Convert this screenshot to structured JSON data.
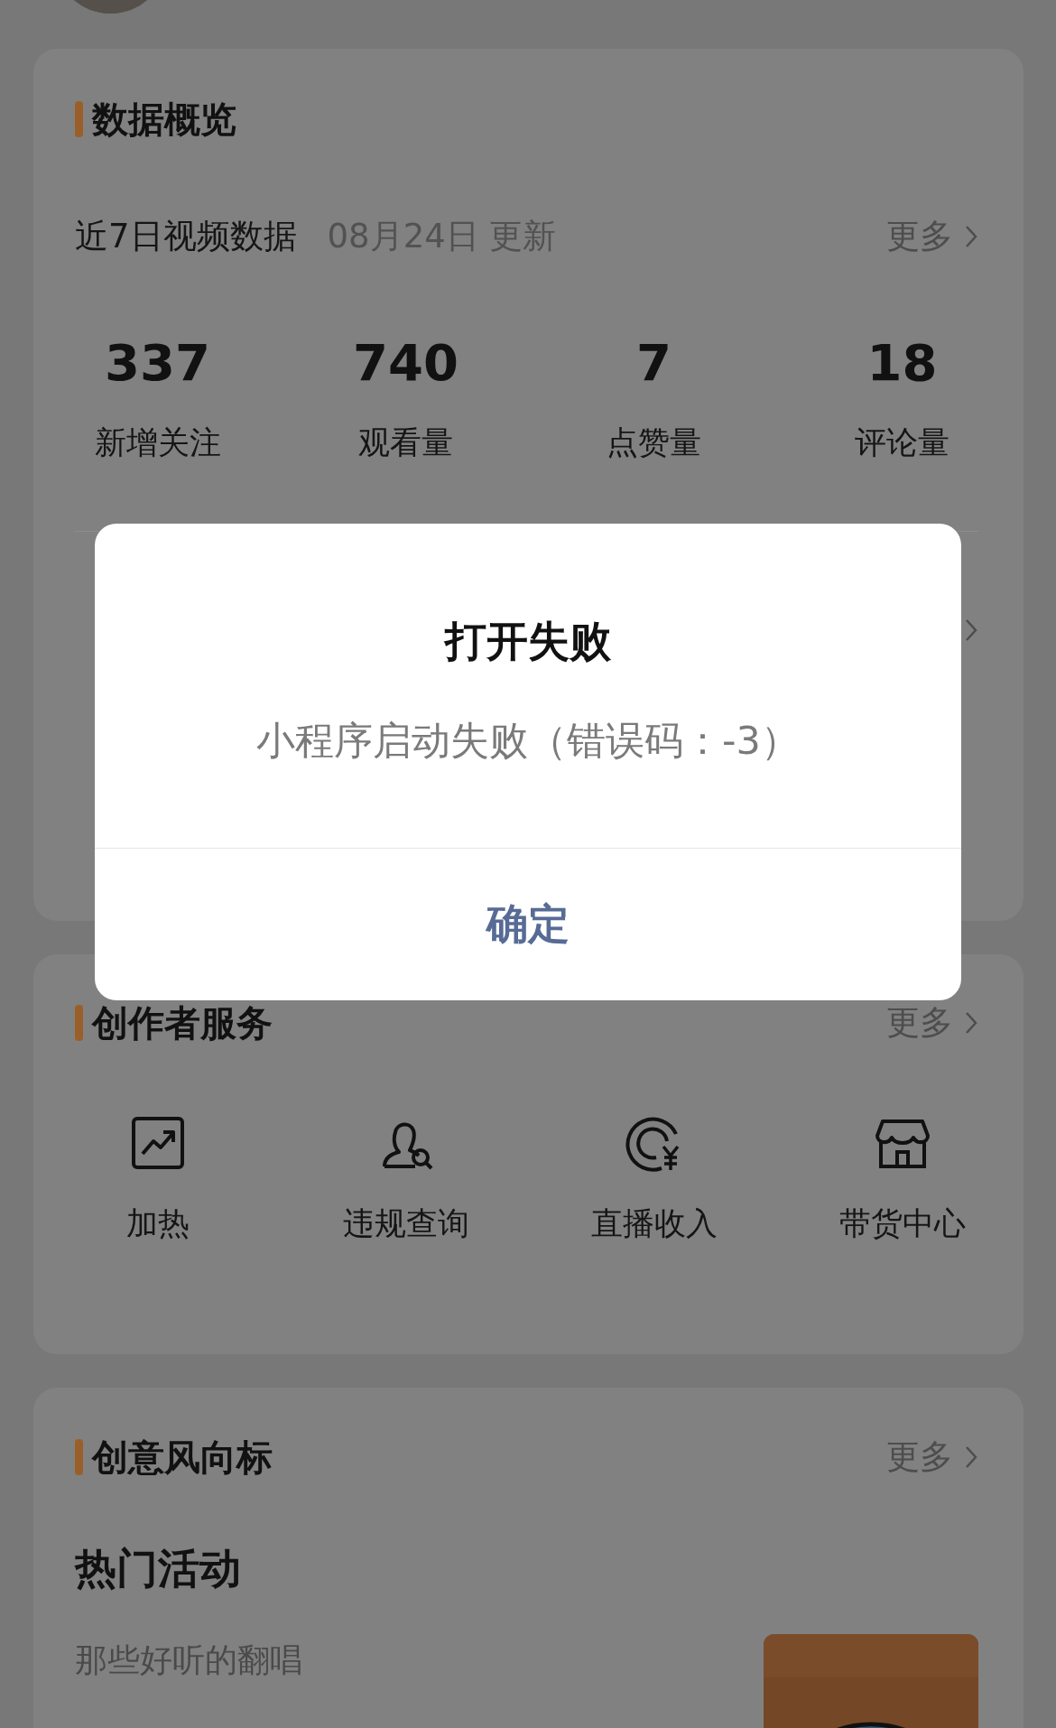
{
  "data_overview": {
    "title": "数据概览",
    "video_row": {
      "label": "近7日视频数据",
      "updated": "08月24日 更新",
      "more": "更多"
    },
    "stats": [
      {
        "value": "337",
        "label": "新增关注"
      },
      {
        "value": "740",
        "label": "观看量"
      },
      {
        "value": "7",
        "label": "点赞量"
      },
      {
        "value": "18",
        "label": "评论量"
      }
    ],
    "second_row": {
      "kind": "link"
    }
  },
  "creator_services": {
    "title": "创作者服务",
    "more": "更多",
    "items": [
      {
        "label": "加热",
        "kind": "chart"
      },
      {
        "label": "违规查询",
        "kind": "person-search"
      },
      {
        "label": "直播收入",
        "kind": "yuan"
      },
      {
        "label": "带货中心",
        "kind": "shop"
      }
    ]
  },
  "creative_trends": {
    "title": "创意风向标",
    "more": "更多",
    "activity": {
      "heading": "热门活动",
      "name": "那些好听的翻唱"
    }
  },
  "dialog": {
    "title": "打开失败",
    "message": "小程序启动失败（错误码：-3）",
    "button": "确定"
  }
}
